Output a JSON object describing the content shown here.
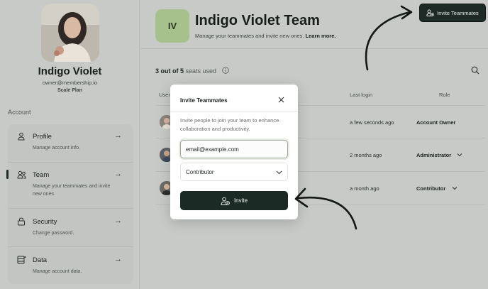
{
  "profile": {
    "name": "Indigo Violet",
    "email": "owner@membership.io",
    "plan": "Scale Plan"
  },
  "sidebar": {
    "section_label": "Account",
    "items": [
      {
        "title": "Profile",
        "desc": "Manage account info.",
        "icon": "user-icon",
        "arrow": "→"
      },
      {
        "title": "Team",
        "desc": "Manage your teammates and invite new ones.",
        "icon": "team-icon",
        "arrow": "→",
        "active": true
      },
      {
        "title": "Security",
        "desc": "Change password.",
        "icon": "lock-icon",
        "arrow": "→"
      },
      {
        "title": "Data",
        "desc": "Manage account data.",
        "icon": "database-icon",
        "arrow": "→"
      }
    ]
  },
  "header": {
    "badge": "IV",
    "title": "Indigo Violet Team",
    "subtitle": "Manage your teammates and invite new ones.",
    "learn_more": "Learn more.",
    "invite_button": "Invite Teammates"
  },
  "seats": {
    "used_text": "3 out of 5",
    "suffix": "seats used"
  },
  "table": {
    "columns": [
      "User",
      "Last login",
      "Role"
    ],
    "rows": [
      {
        "last_login": "a few seconds ago",
        "role": "Account Owner",
        "has_dropdown": false
      },
      {
        "last_login": "2 months ago",
        "role": "Administrator",
        "has_dropdown": true
      },
      {
        "last_login": "a month ago",
        "role": "Contributor",
        "has_dropdown": true
      }
    ]
  },
  "modal": {
    "title": "Invite Teammates",
    "description": "Invite people to join your team to enhance collaboration and productivity.",
    "email_value": "email@example.com",
    "role_value": "Contributor",
    "invite_label": "Invite"
  },
  "colors": {
    "accent_dark": "#1c2a25",
    "badge_green": "#a7c18c"
  }
}
